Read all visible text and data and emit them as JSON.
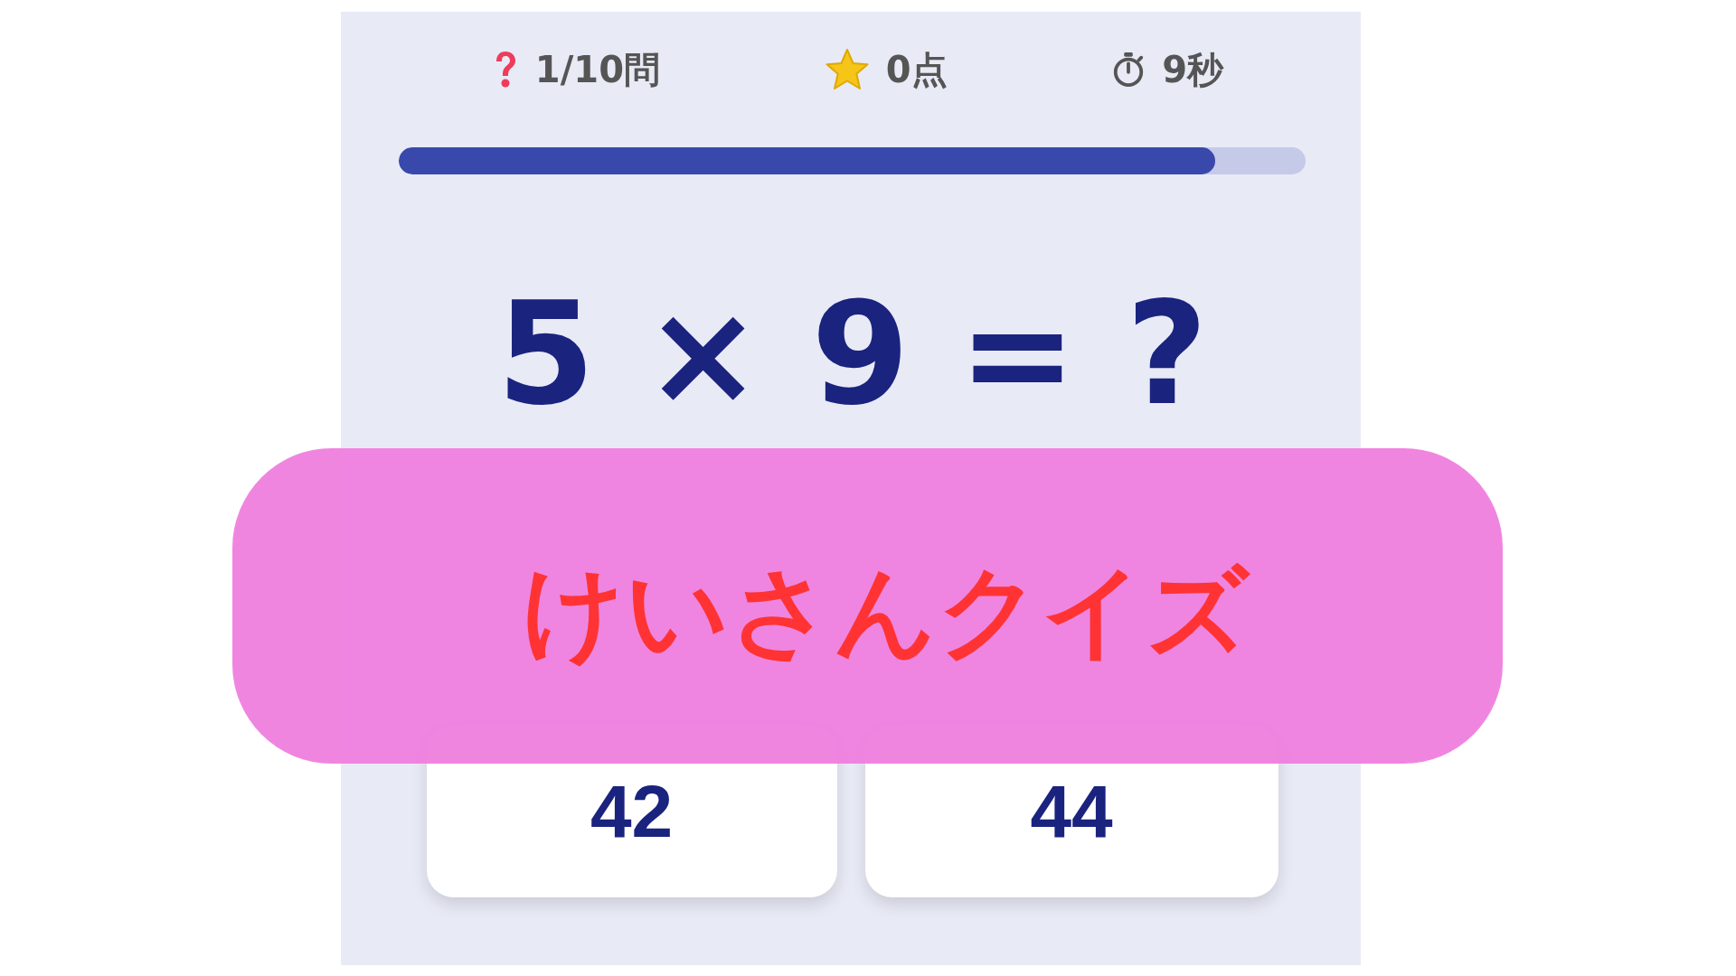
{
  "stats": [
    {
      "kind": "question",
      "text": "1/10問"
    },
    {
      "kind": "score",
      "text": "0点"
    },
    {
      "kind": "time",
      "text": "9秒"
    }
  ],
  "progress": {
    "level": 0.9
  },
  "question": {
    "text": "5 × 9 = ?"
  },
  "answers": [
    {
      "label": "42"
    },
    {
      "label": "44"
    }
  ],
  "banner": {
    "title": "けいさんクイズ"
  }
}
